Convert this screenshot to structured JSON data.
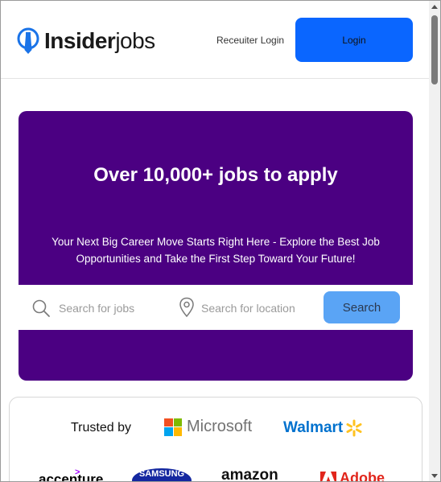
{
  "header": {
    "logo_bold": "Insider",
    "logo_light": "jobs",
    "recruiter_login": "Receuiter Login",
    "login_label": "Login"
  },
  "hero": {
    "title": "Over 10,000+ jobs to apply",
    "subtitle": "Your Next Big Career Move Starts Right Here - Explore the Best Job Opportunities and Take the First Step Toward Your Future!",
    "search": {
      "placeholder": "Search for jobs",
      "location_placeholder": "Search for location",
      "button_label": "Search"
    }
  },
  "trusted": {
    "label": "Trusted by",
    "brands": [
      "Microsoft",
      "Walmart",
      "accenture",
      "SAMSUNG",
      "amazon",
      "Adobe"
    ]
  },
  "colors": {
    "hero_bg": "#4b0082",
    "login_bg": "#0a66ff",
    "search_bg": "#5aa4f5"
  }
}
